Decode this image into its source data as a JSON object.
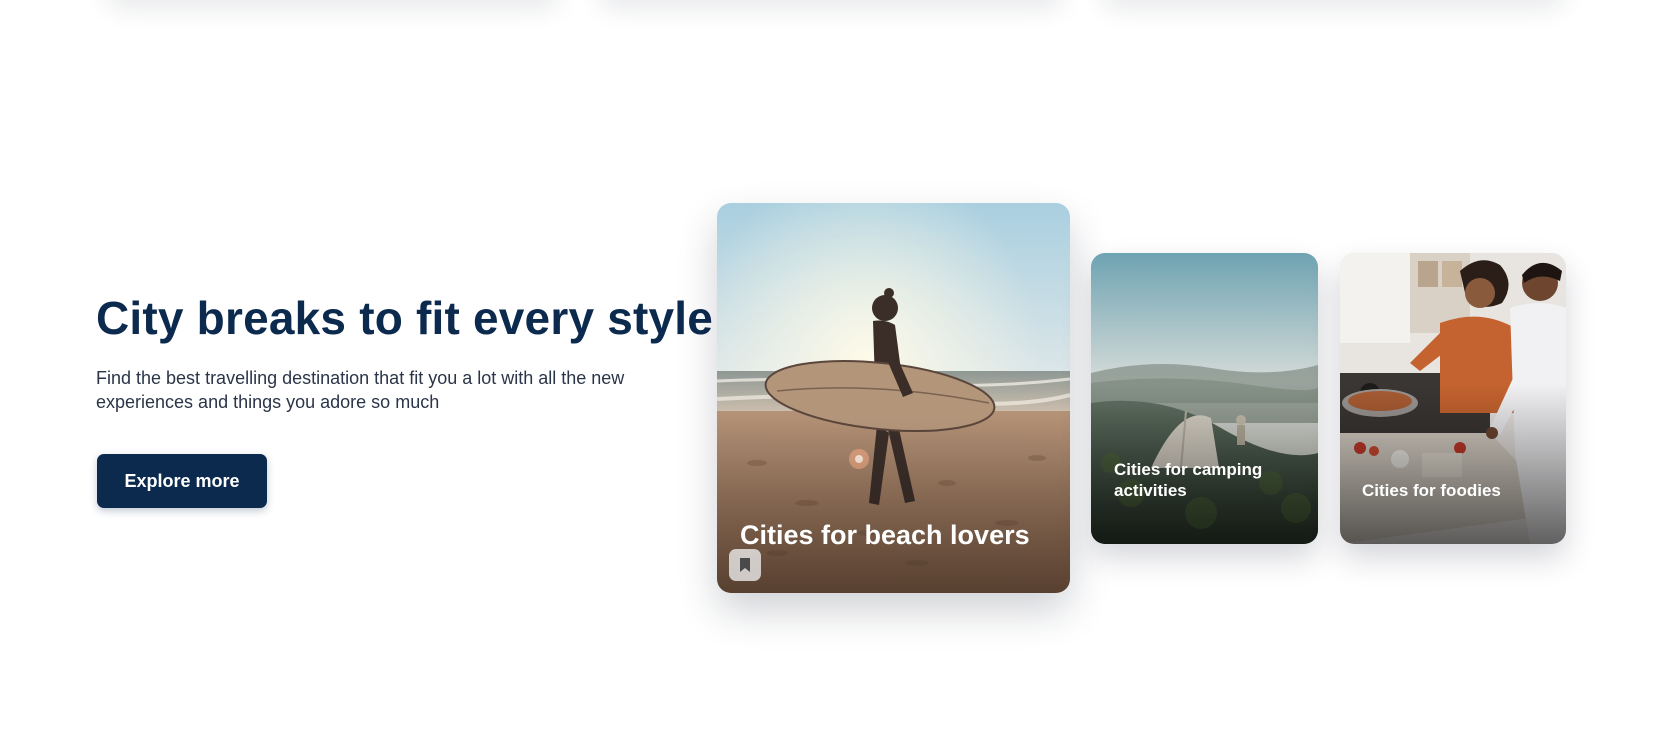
{
  "hero": {
    "title": "City breaks to fit every style",
    "subtitle": "Find the best travelling destination that fit you a lot with all the new experiences and things you adore so much",
    "cta_label": "Explore more"
  },
  "cards": [
    {
      "label": "Cities for beach lovers",
      "image": "surfer-on-beach-at-sunset",
      "bookmark_icon": "bookmark-icon"
    },
    {
      "label": "Cities for camping activities",
      "image": "tent-on-mountain-hillside"
    },
    {
      "label": "Cities for foodies",
      "image": "couple-cooking-in-kitchen"
    }
  ],
  "colors": {
    "brand_navy": "#0b2a4e",
    "body_text": "#2b3548",
    "background": "#ffffff",
    "card_label": "#ffffff"
  }
}
